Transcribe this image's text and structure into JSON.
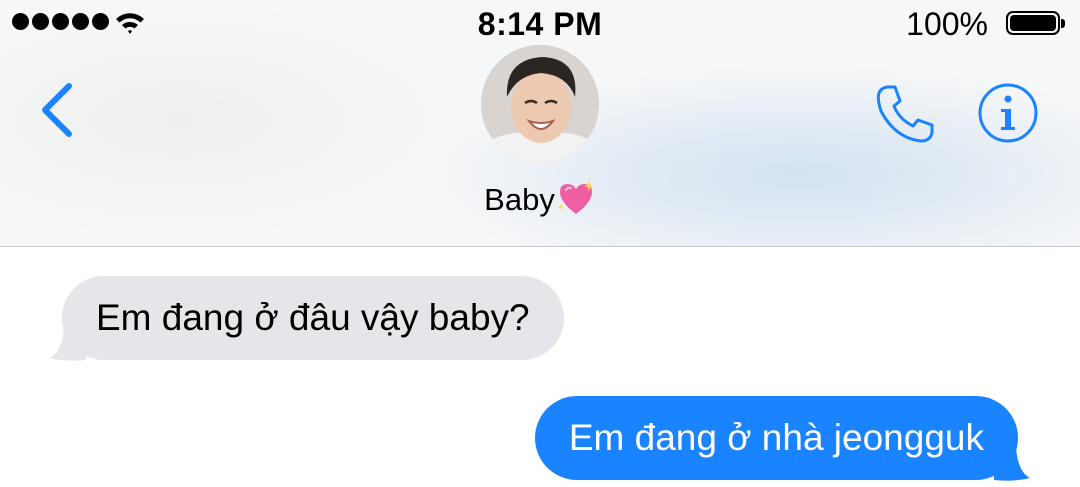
{
  "status_bar": {
    "time": "8:14 PM",
    "battery_percent": "100%",
    "signal_bars": 5,
    "icons": [
      "signal-dots-icon",
      "wifi-icon",
      "battery-icon"
    ]
  },
  "nav": {
    "back_icon": "chevron-left-icon",
    "contact_name": "Baby",
    "contact_emoji": "sparkling-heart-emoji",
    "phone_icon": "phone-icon",
    "info_icon": "info-icon"
  },
  "conversation": {
    "messages": [
      {
        "direction": "incoming",
        "text": "Em đang ở đâu vậy baby?"
      },
      {
        "direction": "outgoing",
        "text": "Em đang ở nhà jeongguk"
      }
    ]
  },
  "colors": {
    "accent": "#1a83ff",
    "incoming_bubble": "#e5e5ea",
    "header_divider": "#c7c7cc"
  }
}
